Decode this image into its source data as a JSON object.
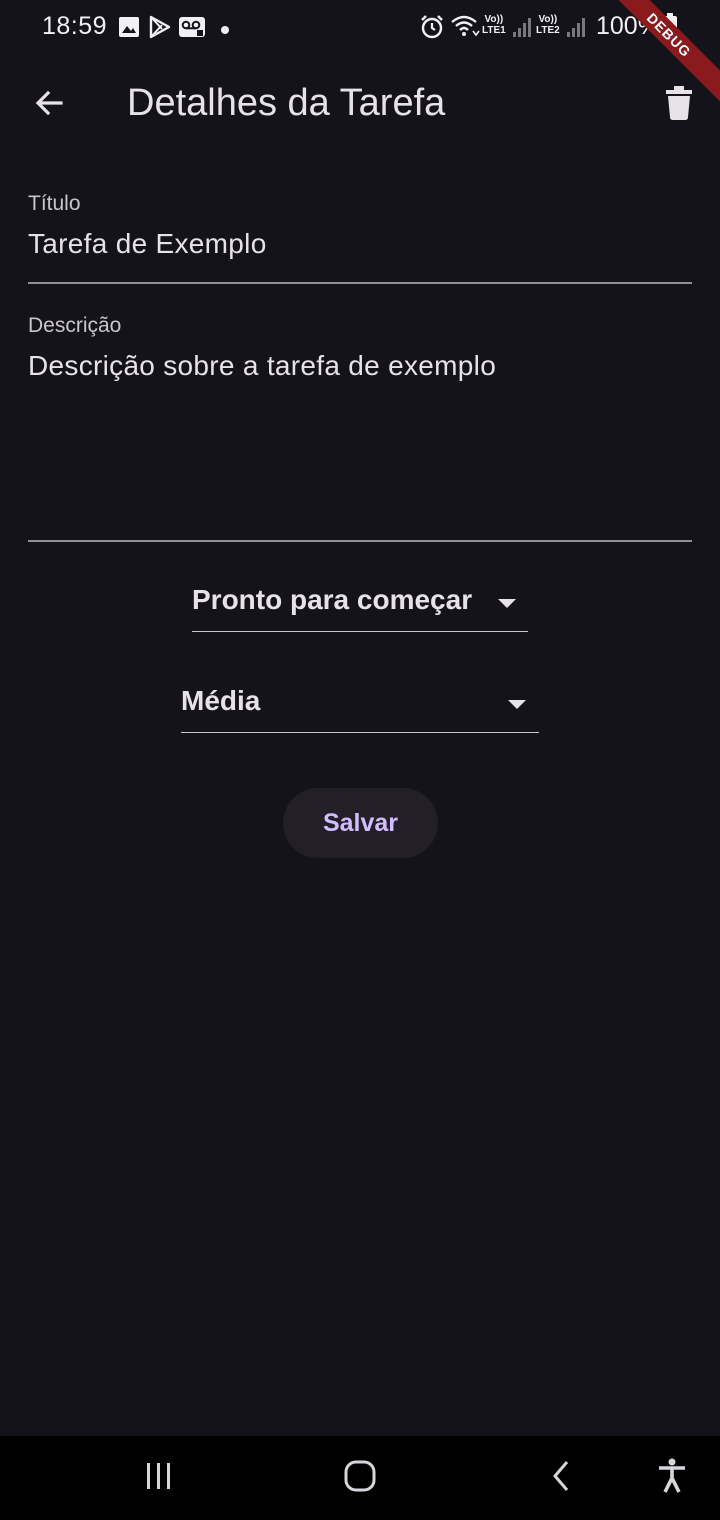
{
  "status_bar": {
    "time": "18:59",
    "battery": "100%",
    "sim1": {
      "top": "Vo))",
      "bottom": "LTE1"
    },
    "sim2": {
      "top": "Vo))",
      "bottom": "LTE2"
    },
    "icons": [
      "image-icon",
      "play-store-icon",
      "voicemail-icon",
      "dot-icon",
      "alarm-icon",
      "wifi-icon",
      "signal-icon",
      "signal-icon",
      "battery-icon"
    ]
  },
  "debug_banner": "DEBUG",
  "app_bar": {
    "title": "Detalhes da Tarefa",
    "back_icon": "arrow-back-icon",
    "delete_icon": "trash-icon"
  },
  "form": {
    "title_field": {
      "label": "Título",
      "value": "Tarefa de Exemplo"
    },
    "description_field": {
      "label": "Descrição",
      "value": "Descrição sobre a tarefa de exemplo"
    },
    "status_dropdown": {
      "selected": "Pronto para começar"
    },
    "priority_dropdown": {
      "selected": "Média"
    },
    "save_label": "Salvar"
  },
  "nav_bar": {
    "icons": [
      "recent-apps-icon",
      "home-icon",
      "back-icon",
      "accessibility-icon"
    ]
  },
  "colors": {
    "background": "#15131a",
    "text": "#e7e1e8",
    "accent": "#d0bcff",
    "debug": "#8b1a1f"
  }
}
